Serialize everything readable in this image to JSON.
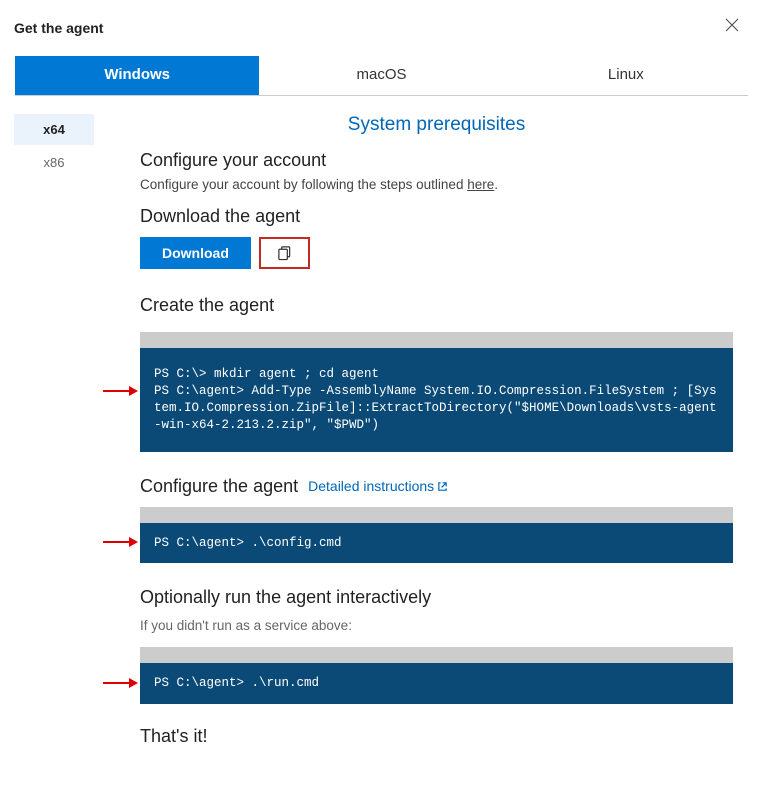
{
  "header": {
    "title": "Get the agent"
  },
  "os_tabs": {
    "windows": "Windows",
    "macos": "macOS",
    "linux": "Linux"
  },
  "arch": {
    "x64": "x64",
    "x86": "x86"
  },
  "prereq_link": "System prerequisites",
  "configure_account": {
    "title": "Configure your account",
    "text_prefix": "Configure your account by following the steps outlined ",
    "link": "here",
    "text_suffix": "."
  },
  "download": {
    "title": "Download the agent",
    "button": "Download"
  },
  "create_agent": {
    "title": "Create the agent",
    "code": "PS C:\\> mkdir agent ; cd agent\nPS C:\\agent> Add-Type -AssemblyName System.IO.Compression.FileSystem ; [System.IO.Compression.ZipFile]::ExtractToDirectory(\"$HOME\\Downloads\\vsts-agent-win-x64-2.213.2.zip\", \"$PWD\")"
  },
  "configure_agent": {
    "title": "Configure the agent",
    "detail_link": "Detailed instructions",
    "code": "PS C:\\agent> .\\config.cmd"
  },
  "run_agent": {
    "title": "Optionally run the agent interactively",
    "note": "If you didn't run as a service above:",
    "code": "PS C:\\agent> .\\run.cmd"
  },
  "done": {
    "title": "That's it!"
  }
}
